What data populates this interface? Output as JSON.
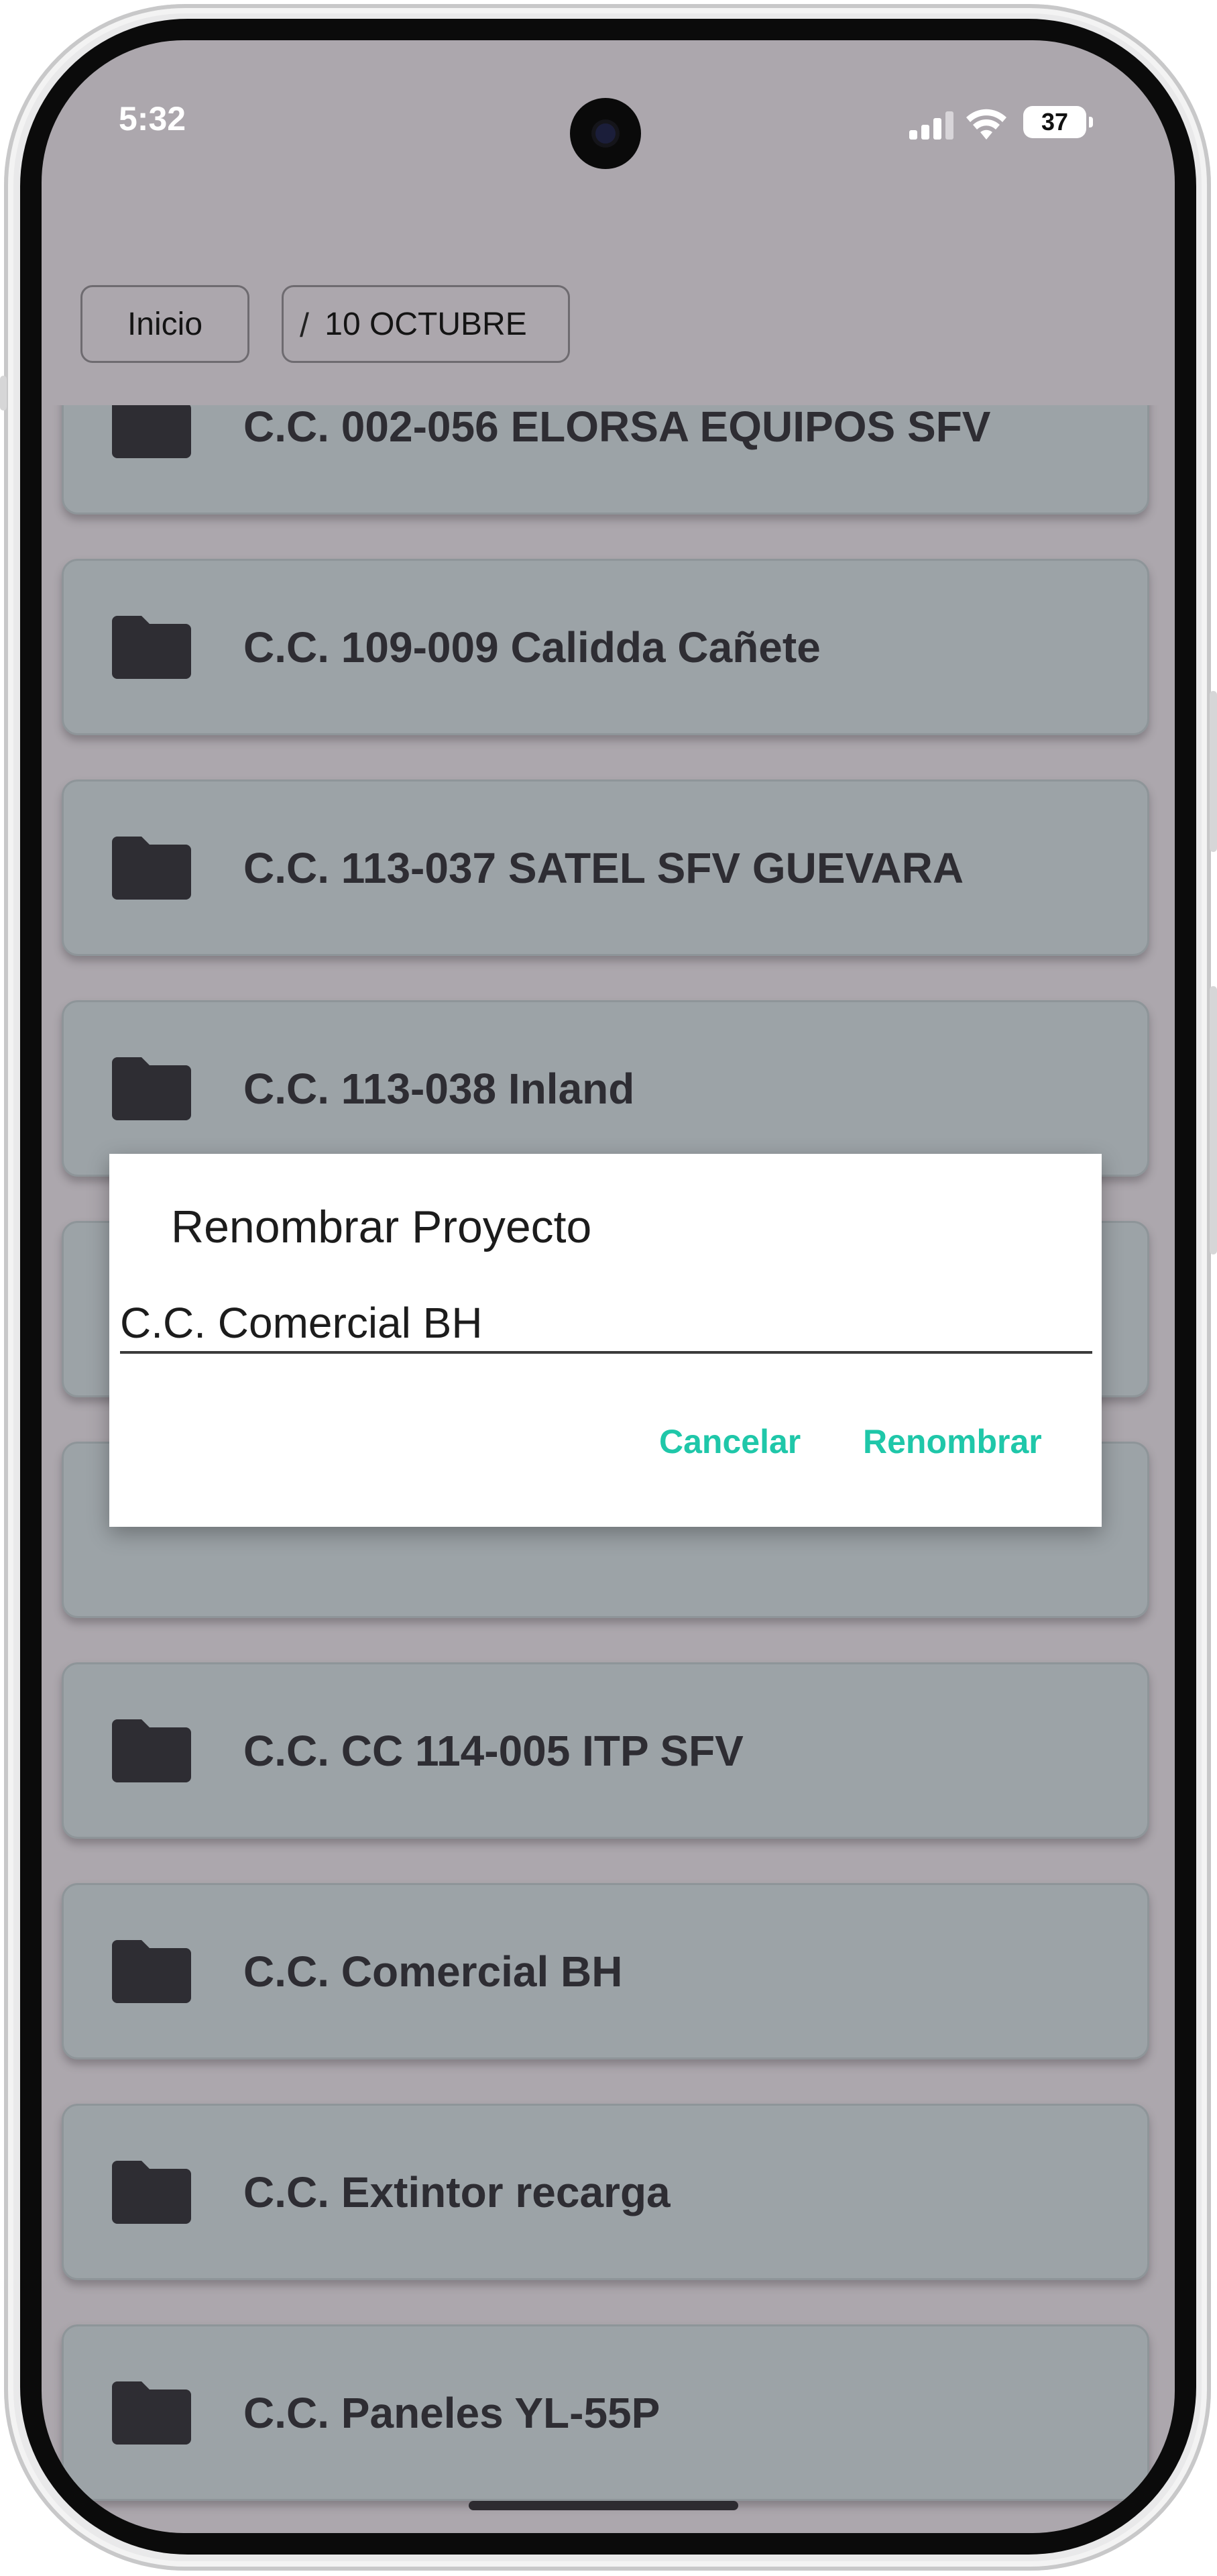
{
  "status_bar": {
    "time": "5:32",
    "battery": "37"
  },
  "breadcrumb": {
    "home": "Inicio",
    "separator": "/",
    "current": "10 OCTUBRE"
  },
  "folders": [
    {
      "label": "C.C. 002-056 ELORSA EQUIPOS SFV"
    },
    {
      "label": "C.C. 109-009 Calidda Cañete"
    },
    {
      "label": "C.C. 113-037 SATEL SFV GUEVARA"
    },
    {
      "label": "C.C. 113-038 Inland"
    },
    {
      "label": ""
    },
    {
      "label": ""
    },
    {
      "label": "C.C. CC 114-005 ITP SFV"
    },
    {
      "label": "C.C. Comercial BH"
    },
    {
      "label": "C.C. Extintor recarga"
    },
    {
      "label": "C.C. Paneles YL-55P"
    }
  ],
  "dialog": {
    "title": "Renombrar Proyecto",
    "input_value": "C.C. Comercial BH",
    "cancel_label": "Cancelar",
    "confirm_label": "Renombrar"
  },
  "colors": {
    "accent": "#1fc7a9",
    "overlay_background": "#aca7ad",
    "card_background": "#9ca3a7",
    "icon_color": "#2e2d33"
  },
  "icons": {
    "folder": "folder-icon",
    "signal": "cellular-signal-icon",
    "wifi": "wifi-icon",
    "battery": "battery-icon"
  }
}
